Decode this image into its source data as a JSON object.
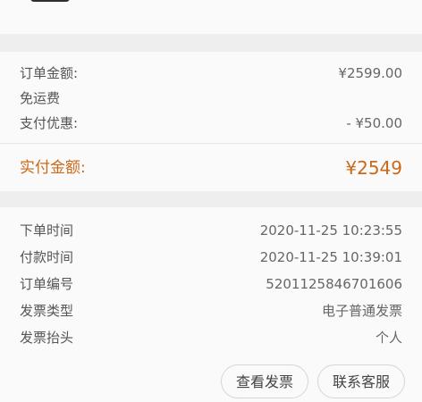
{
  "summary": {
    "order_amount_label": "订单金额:",
    "order_amount_value": "¥2599.00",
    "shipping_label": "免运费",
    "discount_label": "支付优惠:",
    "discount_value": "- ¥50.00",
    "paid_amount_label": "实付金额:",
    "paid_amount_value": "¥2549"
  },
  "details": {
    "rows": [
      {
        "label": "下单时间",
        "value": "2020-11-25 10:23:55"
      },
      {
        "label": "付款时间",
        "value": "2020-11-25 10:39:01"
      },
      {
        "label": "订单编号",
        "value": "5201125846701606"
      },
      {
        "label": "发票类型",
        "value": "电子普通发票"
      },
      {
        "label": "发票抬头",
        "value": "个人"
      }
    ]
  },
  "actions": {
    "view_invoice_label": "查看发票",
    "contact_service_label": "联系客服"
  },
  "colors": {
    "accent_orange": "#c96a1a",
    "page_background": "#f7f7f7",
    "section_background": "#fafafa",
    "gap_background": "#eeeeee"
  }
}
